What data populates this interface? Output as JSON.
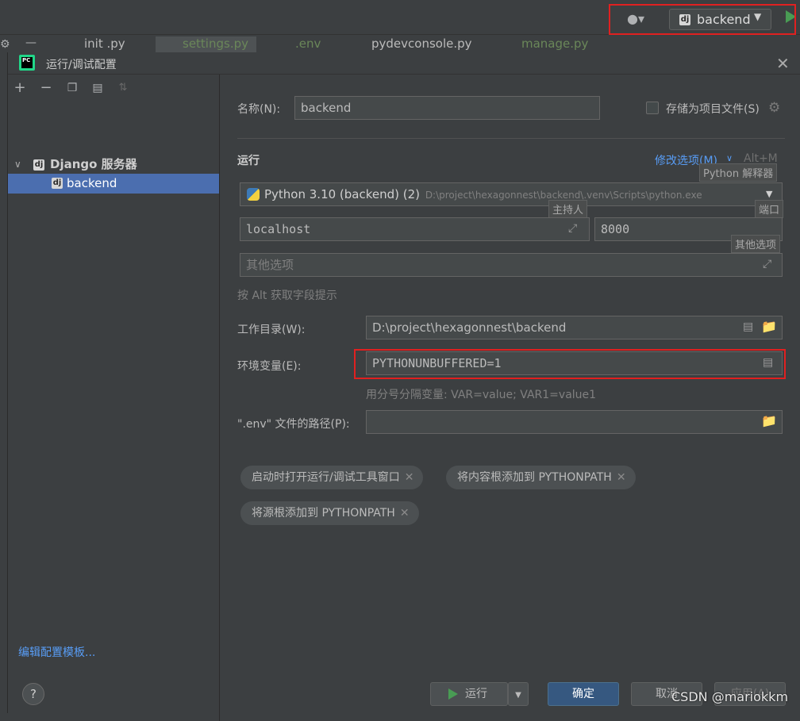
{
  "ide": {
    "run_config_name": "backend",
    "tabs": [
      "init .py",
      "settings.py",
      ".env",
      "pydevconsole.py",
      "manage.py"
    ]
  },
  "dialog": {
    "title": "运行/调试配置",
    "tree": {
      "group_label": "Django 服务器",
      "item_label": "backend"
    },
    "edit_templates_link": "编辑配置模板...",
    "name_label": "名称(N):",
    "name_value": "backend",
    "store_as_project_file_label": "存储为项目文件(S)",
    "run_section_title": "运行",
    "modify_options_label": "修改选项(M)",
    "modify_options_shortcut": "Alt+M",
    "interpreter": {
      "tooltip": "Python 解释器",
      "name": "Python 3.10 (backend) (2)",
      "path": "D:\\project\\hexagonnest\\backend\\.venv\\Scripts\\python.exe"
    },
    "host": {
      "tooltip": "主持人",
      "value": "localhost"
    },
    "port": {
      "tooltip": "端口",
      "value": "8000"
    },
    "other_options": {
      "tooltip": "其他选项",
      "placeholder": "其他选项"
    },
    "alt_hint": "按 Alt 获取字段提示",
    "workdir_label": "工作目录(W):",
    "workdir_value": "D:\\project\\hexagonnest\\backend",
    "env_label": "环境变量(E):",
    "env_value": "PYTHONUNBUFFERED=1",
    "env_hint": "用分号分隔变量: VAR=value; VAR1=value1",
    "dotenv_label": "\".env\" 文件的路径(P):",
    "dotenv_value": "",
    "chips": [
      "启动时打开运行/调试工具窗口",
      "将内容根添加到 PYTHONPATH",
      "将源根添加到 PYTHONPATH"
    ],
    "buttons": {
      "help": "?",
      "run": "运行",
      "ok": "确定",
      "cancel": "取消",
      "apply": "应用(A)"
    }
  },
  "watermark": "CSDN @mariokkm",
  "colors": {
    "accent": "#4b6eaf",
    "link": "#589df6",
    "highlight_box": "#e02020",
    "run_green": "#499c54"
  }
}
